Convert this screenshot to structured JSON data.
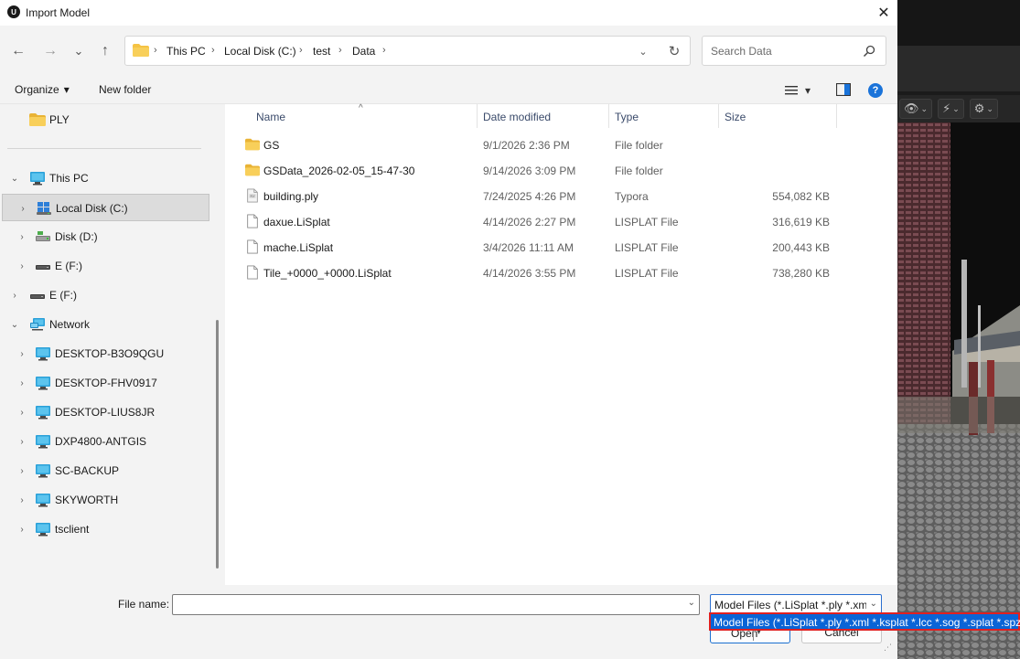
{
  "window": {
    "title": "Import Model",
    "app_icon": "unreal-engine-logo",
    "close_glyph": "✕"
  },
  "navigation": {
    "back_icon": "←",
    "forward_icon": "→",
    "recent_icon": "⌄",
    "up_icon": "↑",
    "breadcrumb": [
      "This PC",
      "Local Disk (C:)",
      "test",
      "Data"
    ],
    "separator": "›",
    "refresh_icon": "↻",
    "dropdown_icon": "⌄"
  },
  "search": {
    "placeholder": "Search Data"
  },
  "commandbar": {
    "organize_label": "Organize",
    "new_folder_label": "New folder",
    "dropdown_glyph": "▾",
    "help_glyph": "?"
  },
  "navpane": {
    "items": [
      {
        "label": "PLY",
        "icon": "folder-icon",
        "chevron": ""
      },
      {
        "label": "This PC",
        "icon": "this-pc-icon",
        "chevron": "⌄"
      },
      {
        "label": "Local Disk (C:)",
        "icon": "windows-drive-icon",
        "chevron": "›"
      },
      {
        "label": "Disk (D:)",
        "icon": "drive-icon",
        "chevron": "›"
      },
      {
        "label": "E (F:)",
        "icon": "usb-drive-icon",
        "chevron": "›"
      },
      {
        "label": "E (F:)",
        "icon": "usb-drive-icon",
        "chevron": "›"
      },
      {
        "label": "Network",
        "icon": "network-icon",
        "chevron": "⌄"
      },
      {
        "label": "DESKTOP-B3O9QGU",
        "icon": "computer-icon",
        "chevron": "›"
      },
      {
        "label": "DESKTOP-FHV0917",
        "icon": "computer-icon",
        "chevron": "›"
      },
      {
        "label": "DESKTOP-LIUS8JR",
        "icon": "computer-icon",
        "chevron": "›"
      },
      {
        "label": "DXP4800-ANTGIS",
        "icon": "computer-icon",
        "chevron": "›"
      },
      {
        "label": "SC-BACKUP",
        "icon": "computer-icon",
        "chevron": "›"
      },
      {
        "label": "SKYWORTH",
        "icon": "computer-icon",
        "chevron": "›"
      },
      {
        "label": "tsclient",
        "icon": "computer-icon",
        "chevron": "›"
      }
    ]
  },
  "filelist": {
    "columns": {
      "name": "Name",
      "date": "Date modified",
      "type": "Type",
      "size": "Size"
    },
    "sort_glyph": "^",
    "files": [
      {
        "name": "GS",
        "date": "9/1/2026 2:36 PM",
        "type": "File folder",
        "size": "",
        "icon": "folder-icon"
      },
      {
        "name": "GSData_2026-02-05_15-47-30",
        "date": "9/14/2026 3:09 PM",
        "type": "File folder",
        "size": "",
        "icon": "folder-icon"
      },
      {
        "name": "building.ply",
        "date": "7/24/2025 4:26 PM",
        "type": "Typora",
        "size": "554,082 KB",
        "icon": "ply-file-icon"
      },
      {
        "name": "daxue.LiSplat",
        "date": "4/14/2026 2:27 PM",
        "type": "LISPLAT File",
        "size": "316,619 KB",
        "icon": "file-icon"
      },
      {
        "name": "mache.LiSplat",
        "date": "3/4/2026 11:11 AM",
        "type": "LISPLAT File",
        "size": "200,443 KB",
        "icon": "file-icon"
      },
      {
        "name": "Tile_+0000_+0000.LiSplat",
        "date": "4/14/2026 3:55 PM",
        "type": "LISPLAT File",
        "size": "738,280 KB",
        "icon": "file-icon"
      }
    ]
  },
  "bottom": {
    "filename_label": "File name:",
    "filename_value": "",
    "filetype_selected": "Model Files (*.LiSplat *.ply *.xm",
    "filetype_option": "Model Files (*.LiSplat *.ply *.xml *.ksplat *.lcc *.sog *.splat *.spz)",
    "open_label": "Open",
    "cancel_label": "Cancel",
    "dropdown_glyph": "⌄"
  },
  "background_app": {
    "toolbar_icons": [
      "eye-icon",
      "wand-icon",
      "gear-icon"
    ]
  },
  "colors": {
    "accent": "#0a64d6",
    "highlight_border": "#e02020",
    "folder": "#f5c344",
    "selection": "#dcdcdc"
  }
}
